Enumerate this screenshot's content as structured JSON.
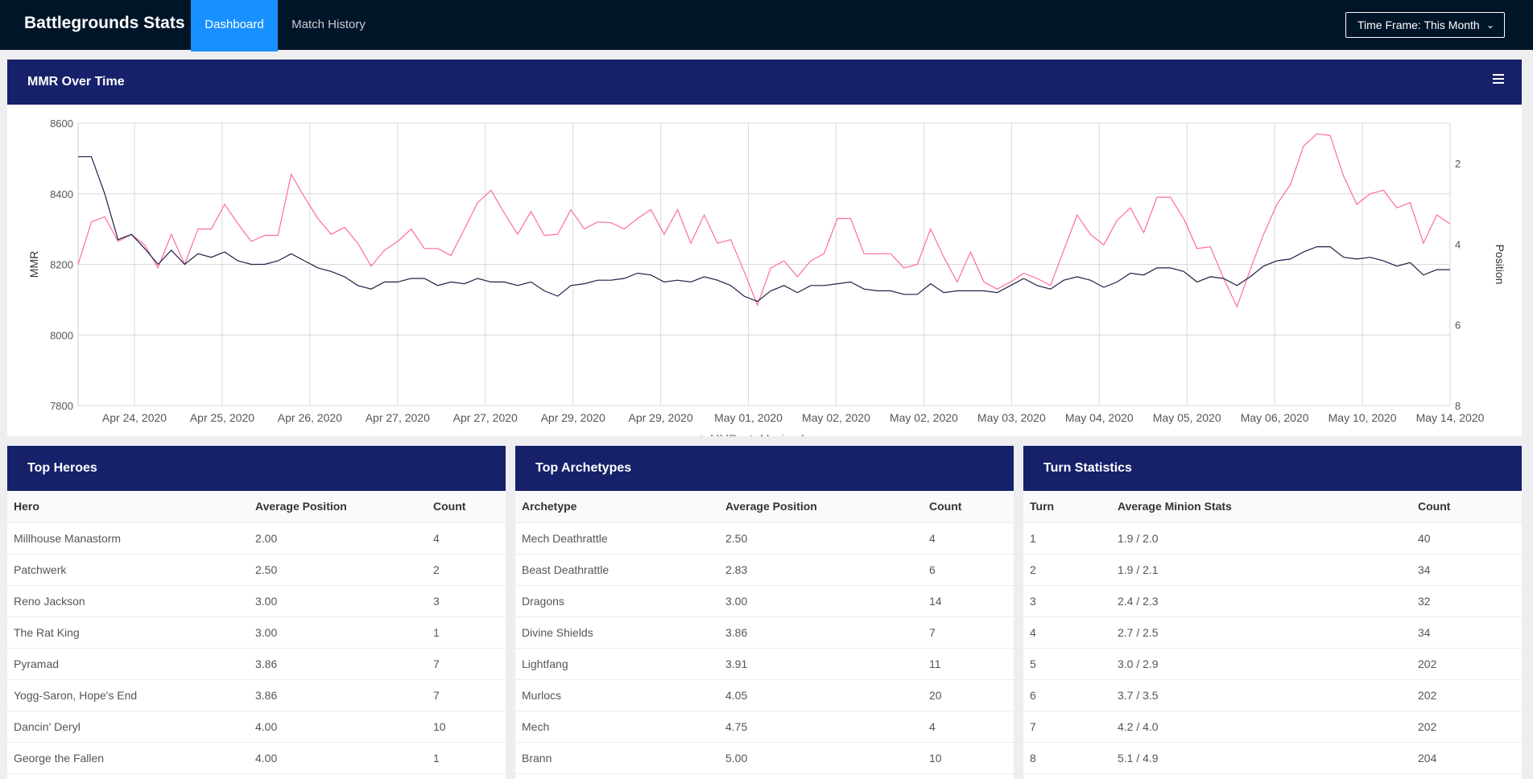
{
  "nav": {
    "brand": "Battlegrounds Stats",
    "tabs": [
      {
        "label": "Dashboard",
        "active": true
      },
      {
        "label": "Match History",
        "active": false
      }
    ],
    "timeframe_label": "Time Frame: This Month",
    "timeframe_icon": "chevron-down-icon"
  },
  "colors": {
    "navbar_bg": "#011529",
    "active_tab": "#1890ff",
    "card_header": "#16216a",
    "mmr_line": "#ff6b9c",
    "moving_average_line": "#1f1f48"
  },
  "mmr_card": {
    "title": "MMR Over Time",
    "menu_icon": "hamburger-menu-icon"
  },
  "chart_data": {
    "type": "line",
    "title": "",
    "ylabel": "MMR",
    "y2label": "Position",
    "ylim": [
      7800,
      8600
    ],
    "y2lim": [
      8,
      1
    ],
    "yticks": [
      "8600",
      "8400",
      "8200",
      "8000",
      "7800"
    ],
    "y2ticks": [
      "2",
      "4",
      "6",
      "8"
    ],
    "xtick_labels": [
      "Apr 24, 2020",
      "Apr 25, 2020",
      "Apr 26, 2020",
      "Apr 27, 2020",
      "Apr 27, 2020",
      "Apr 29, 2020",
      "Apr 29, 2020",
      "May 01, 2020",
      "May 02, 2020",
      "May 02, 2020",
      "May 03, 2020",
      "May 04, 2020",
      "May 05, 2020",
      "May 06, 2020",
      "May 10, 2020",
      "May 14, 2020"
    ],
    "grid": true,
    "legend_position": "bottom-center",
    "series": [
      {
        "name": "MMR",
        "values": [
          8200,
          8320,
          8335,
          8265,
          8285,
          8255,
          8190,
          8285,
          8200,
          8300,
          8300,
          8370,
          8315,
          8265,
          8282,
          8282,
          8455,
          8390,
          8330,
          8285,
          8305,
          8260,
          8195,
          8240,
          8265,
          8300,
          8245,
          8245,
          8225,
          8300,
          8375,
          8410,
          8345,
          8285,
          8350,
          8282,
          8285,
          8355,
          8300,
          8320,
          8318,
          8300,
          8330,
          8355,
          8285,
          8355,
          8260,
          8340,
          8260,
          8270,
          8180,
          8085,
          8190,
          8210,
          8165,
          8210,
          8230,
          8330,
          8330,
          8230,
          8230,
          8230,
          8190,
          8200,
          8300,
          8220,
          8150,
          8235,
          8150,
          8130,
          8150,
          8175,
          8160,
          8140,
          8240,
          8340,
          8285,
          8255,
          8325,
          8360,
          8290,
          8390,
          8390,
          8330,
          8245,
          8250,
          8160,
          8080,
          8185,
          8285,
          8370,
          8425,
          8535,
          8570,
          8565,
          8450,
          8370,
          8400,
          8410,
          8360,
          8375,
          8260,
          8340,
          8315
        ]
      },
      {
        "name": "Moving Average",
        "values": [
          8505,
          8505,
          8400,
          8270,
          8285,
          8245,
          8200,
          8240,
          8200,
          8230,
          8220,
          8235,
          8210,
          8200,
          8200,
          8210,
          8230,
          8210,
          8190,
          8180,
          8165,
          8140,
          8130,
          8150,
          8150,
          8160,
          8160,
          8140,
          8150,
          8145,
          8160,
          8150,
          8150,
          8140,
          8150,
          8125,
          8110,
          8140,
          8145,
          8155,
          8155,
          8160,
          8175,
          8170,
          8150,
          8155,
          8150,
          8165,
          8155,
          8140,
          8110,
          8095,
          8125,
          8140,
          8120,
          8140,
          8140,
          8145,
          8150,
          8130,
          8125,
          8125,
          8115,
          8115,
          8145,
          8120,
          8125,
          8125,
          8125,
          8120,
          8140,
          8160,
          8140,
          8130,
          8155,
          8165,
          8155,
          8135,
          8150,
          8175,
          8170,
          8190,
          8190,
          8180,
          8150,
          8165,
          8160,
          8140,
          8165,
          8195,
          8210,
          8215,
          8235,
          8250,
          8250,
          8220,
          8215,
          8220,
          8210,
          8195,
          8205,
          8170,
          8185,
          8185
        ]
      }
    ]
  },
  "heroes": {
    "title": "Top Heroes",
    "columns": [
      "Hero",
      "Average Position",
      "Count"
    ],
    "rows": [
      [
        "Millhouse Manastorm",
        "2.00",
        "4"
      ],
      [
        "Patchwerk",
        "2.50",
        "2"
      ],
      [
        "Reno Jackson",
        "3.00",
        "3"
      ],
      [
        "The Rat King",
        "3.00",
        "1"
      ],
      [
        "Pyramad",
        "3.86",
        "7"
      ],
      [
        "Yogg-Saron, Hope's End",
        "3.86",
        "7"
      ],
      [
        "Dancin' Deryl",
        "4.00",
        "10"
      ],
      [
        "George the Fallen",
        "4.00",
        "1"
      ]
    ]
  },
  "archetypes": {
    "title": "Top Archetypes",
    "columns": [
      "Archetype",
      "Average Position",
      "Count"
    ],
    "rows": [
      [
        "Mech Deathrattle",
        "2.50",
        "4"
      ],
      [
        "Beast Deathrattle",
        "2.83",
        "6"
      ],
      [
        "Dragons",
        "3.00",
        "14"
      ],
      [
        "Divine Shields",
        "3.86",
        "7"
      ],
      [
        "Lightfang",
        "3.91",
        "11"
      ],
      [
        "Murlocs",
        "4.05",
        "20"
      ],
      [
        "Mech",
        "4.75",
        "4"
      ],
      [
        "Brann",
        "5.00",
        "10"
      ]
    ]
  },
  "turns": {
    "title": "Turn Statistics",
    "columns": [
      "Turn",
      "Average Minion Stats",
      "Count"
    ],
    "rows": [
      [
        "1",
        "1.9 / 2.0",
        "40"
      ],
      [
        "2",
        "1.9 / 2.1",
        "34"
      ],
      [
        "3",
        "2.4 / 2.3",
        "32"
      ],
      [
        "4",
        "2.7 / 2.5",
        "34"
      ],
      [
        "5",
        "3.0 / 2.9",
        "202"
      ],
      [
        "6",
        "3.7 / 3.5",
        "202"
      ],
      [
        "7",
        "4.2 / 4.0",
        "202"
      ],
      [
        "8",
        "5.1 / 4.9",
        "204"
      ]
    ]
  }
}
